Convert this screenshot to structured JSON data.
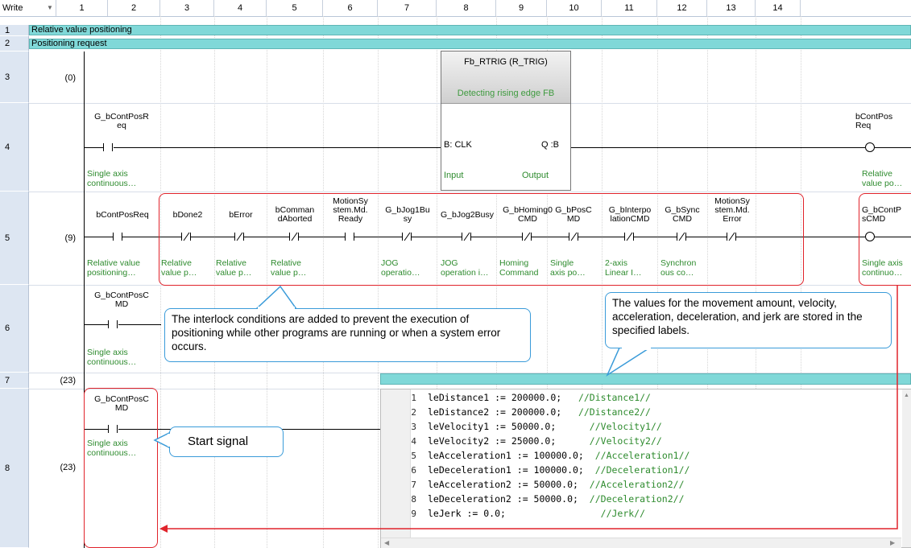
{
  "mode": "Write",
  "columns": [
    "1",
    "2",
    "3",
    "4",
    "5",
    "6",
    "7",
    "8",
    "9",
    "10",
    "11",
    "12",
    "13",
    "14"
  ],
  "rows": {
    "r1": "1",
    "r2": "2",
    "r3": "3",
    "r4": "4",
    "r5": "5",
    "r6": "6",
    "r7": "7",
    "r8": "8"
  },
  "statements": {
    "s1": "Relative value positioning",
    "s2": "Positioning request"
  },
  "steps": {
    "st3": "(0)",
    "st5": "(9)",
    "st7": "(23)",
    "st8": "(23)"
  },
  "fb": {
    "title": "Fb_RTRIG   (R_TRIG)",
    "comment": "Detecting rising edge FB",
    "in_pin": "B: CLK",
    "out_pin": "Q :B",
    "in_label": "Input",
    "out_label": "Output"
  },
  "row4": {
    "contact": "G_bContPosR\neq",
    "contact_cmt": "Single axis\ncontinuous…",
    "coil": "bContPos\nReq",
    "coil_cmt": "Relative\nvalue po…"
  },
  "row5": {
    "c1": "bContPosReq",
    "c1c": "Relative value\npositioning…",
    "c2": "bDone2",
    "c2c": "Relative\nvalue p…",
    "c3": "bError",
    "c3c": "Relative\nvalue p…",
    "c4": "bComman\ndAborted",
    "c4c": "Relative\nvalue p…",
    "c5": "MotionSy\nstem.Md.\nReady",
    "c6": "G_bJog1Bu\nsy",
    "c6c": "JOG\noperatio…",
    "c7": "G_bJog2Busy",
    "c7c": "JOG\noperation i…",
    "c8": "G_bHoming0\nCMD",
    "c8c": "Homing\nCommand",
    "c9": "G_bPosC\nMD",
    "c9c": "Single\naxis po…",
    "c10": "G_bInterpo\nlationCMD",
    "c10c": "2-axis\nLinear I…",
    "c11": "G_bSync\nCMD",
    "c11c": "Synchron\nous co…",
    "c12": "MotionSy\nstem.Md.\nError",
    "coil": "G_bContP\nsCMD",
    "coil_cmt": "Single axis\ncontinuo…"
  },
  "row6": {
    "contact": "G_bContPosC\nMD",
    "contact_cmt": "Single axis\ncontinuous…"
  },
  "row8": {
    "contact": "G_bContPosC\nMD",
    "contact_cmt": "Single axis\ncontinuous…"
  },
  "callouts": {
    "interlock": "The interlock conditions are added to prevent the execution of positioning while other programs are running or when a system error occurs.",
    "values": "The values for the movement amount, velocity, acceleration, deceleration, and jerk are stored in the specified labels.",
    "start": "Start signal"
  },
  "st_code": [
    {
      "n": "1",
      "code": "leDistance1 := 200000.0;",
      "cmt": "//Distance1//"
    },
    {
      "n": "2",
      "code": "leDistance2 := 200000.0;",
      "cmt": "//Distance2//"
    },
    {
      "n": "3",
      "code": "leVelocity1 := 50000.0;",
      "cmt": "//Velocity1//"
    },
    {
      "n": "4",
      "code": "leVelocity2 := 25000.0;",
      "cmt": "//Velocity2//"
    },
    {
      "n": "5",
      "code": "leAcceleration1 := 100000.0;",
      "cmt": "//Acceleration1//"
    },
    {
      "n": "6",
      "code": "leDeceleration1 := 100000.0;",
      "cmt": "//Deceleration1//"
    },
    {
      "n": "7",
      "code": "leAcceleration2 := 50000.0;",
      "cmt": "//Acceleration2//"
    },
    {
      "n": "8",
      "code": "leDeceleration2 := 50000.0;",
      "cmt": "//Deceleration2//"
    },
    {
      "n": "9",
      "code": "leJerk := 0.0;",
      "cmt": "//Jerk//"
    }
  ],
  "colors": {
    "statement_bar": "#80d8d8",
    "comment": "#2e8b2e",
    "callout_border": "#3a9bd9",
    "highlight": "#e0232b",
    "row_header": "#dde6f2"
  }
}
